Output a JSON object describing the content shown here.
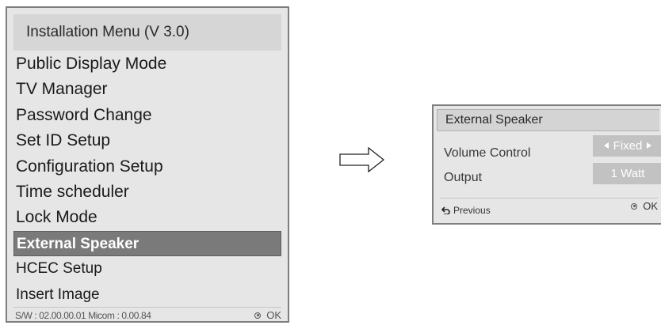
{
  "installation_menu": {
    "title": "Installation Menu (V 3.0)",
    "items": [
      {
        "label": "Public Display Mode",
        "selected": false
      },
      {
        "label": "TV Manager",
        "selected": false
      },
      {
        "label": "Password Change",
        "selected": false
      },
      {
        "label": "Set ID Setup",
        "selected": false
      },
      {
        "label": "Configuration Setup",
        "selected": false
      },
      {
        "label": "Time scheduler",
        "selected": false
      },
      {
        "label": "Lock Mode",
        "selected": false
      },
      {
        "label": "External Speaker",
        "selected": true
      },
      {
        "label": "HCEC Setup",
        "selected": false
      },
      {
        "label": "Insert Image",
        "selected": false
      }
    ],
    "footer": {
      "version_info": "S/W : 02.00.00.01 Micom : 0.00.84",
      "ok_label": "OK"
    }
  },
  "speaker_panel": {
    "title": "External Speaker",
    "volume_control": {
      "label": "Volume Control",
      "value": "Fixed"
    },
    "output": {
      "label": "Output",
      "value": "1 Watt"
    },
    "footer": {
      "previous_label": "Previous",
      "ok_label": "OK"
    }
  },
  "icons": {
    "arrow": "right-arrow-icon",
    "previous": "back-return-icon",
    "ok": "ok-button-icon"
  },
  "colors": {
    "menu_background": "#e6e6e6",
    "header_background": "#d6d6d6",
    "selected_background": "#7a7a7a",
    "value_box": "#c2c2c2"
  }
}
